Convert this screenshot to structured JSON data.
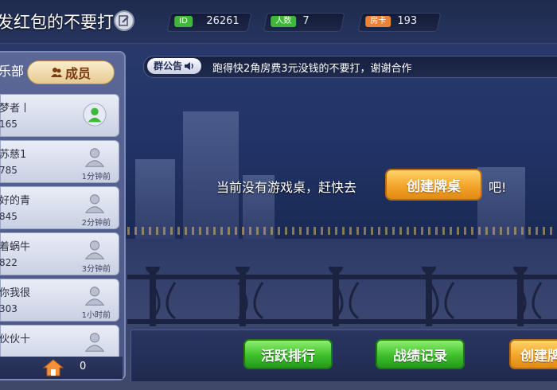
{
  "header": {
    "club_title": "发红包的不要打",
    "stats": [
      {
        "tag": "ID",
        "value": "26261",
        "color": "#3fb83a"
      },
      {
        "tag": "人数",
        "value": "7",
        "color": "#3fb83a"
      },
      {
        "tag": "房卡",
        "value": "193",
        "color": "#e9833a"
      }
    ]
  },
  "left_panel": {
    "tab_club": "乐部",
    "tab_members": "成员",
    "members": [
      {
        "name": "梦者丨",
        "id": "165",
        "status": ""
      },
      {
        "name": "苏慈1",
        "id": "785",
        "status": "1分钟前"
      },
      {
        "name": "好的青",
        "id": "845",
        "status": "2分钟前"
      },
      {
        "name": "着蜗牛",
        "id": "822",
        "status": "3分钟前"
      },
      {
        "name": "你我很",
        "id": "303",
        "status": "1小时前"
      },
      {
        "name": "伙伙十",
        "id": "",
        "status": ""
      }
    ],
    "house_count": "0"
  },
  "notice": {
    "tag": "群公告",
    "text": "跑得快2角房费3元没钱的不要打，谢谢合作"
  },
  "center": {
    "message": "当前没有游戏桌，赶快去",
    "create_button": "创建牌桌",
    "tail": "吧!"
  },
  "bottom": {
    "rank_button": "活跃排行",
    "record_button": "战绩记录",
    "create_button": "创建牌"
  }
}
